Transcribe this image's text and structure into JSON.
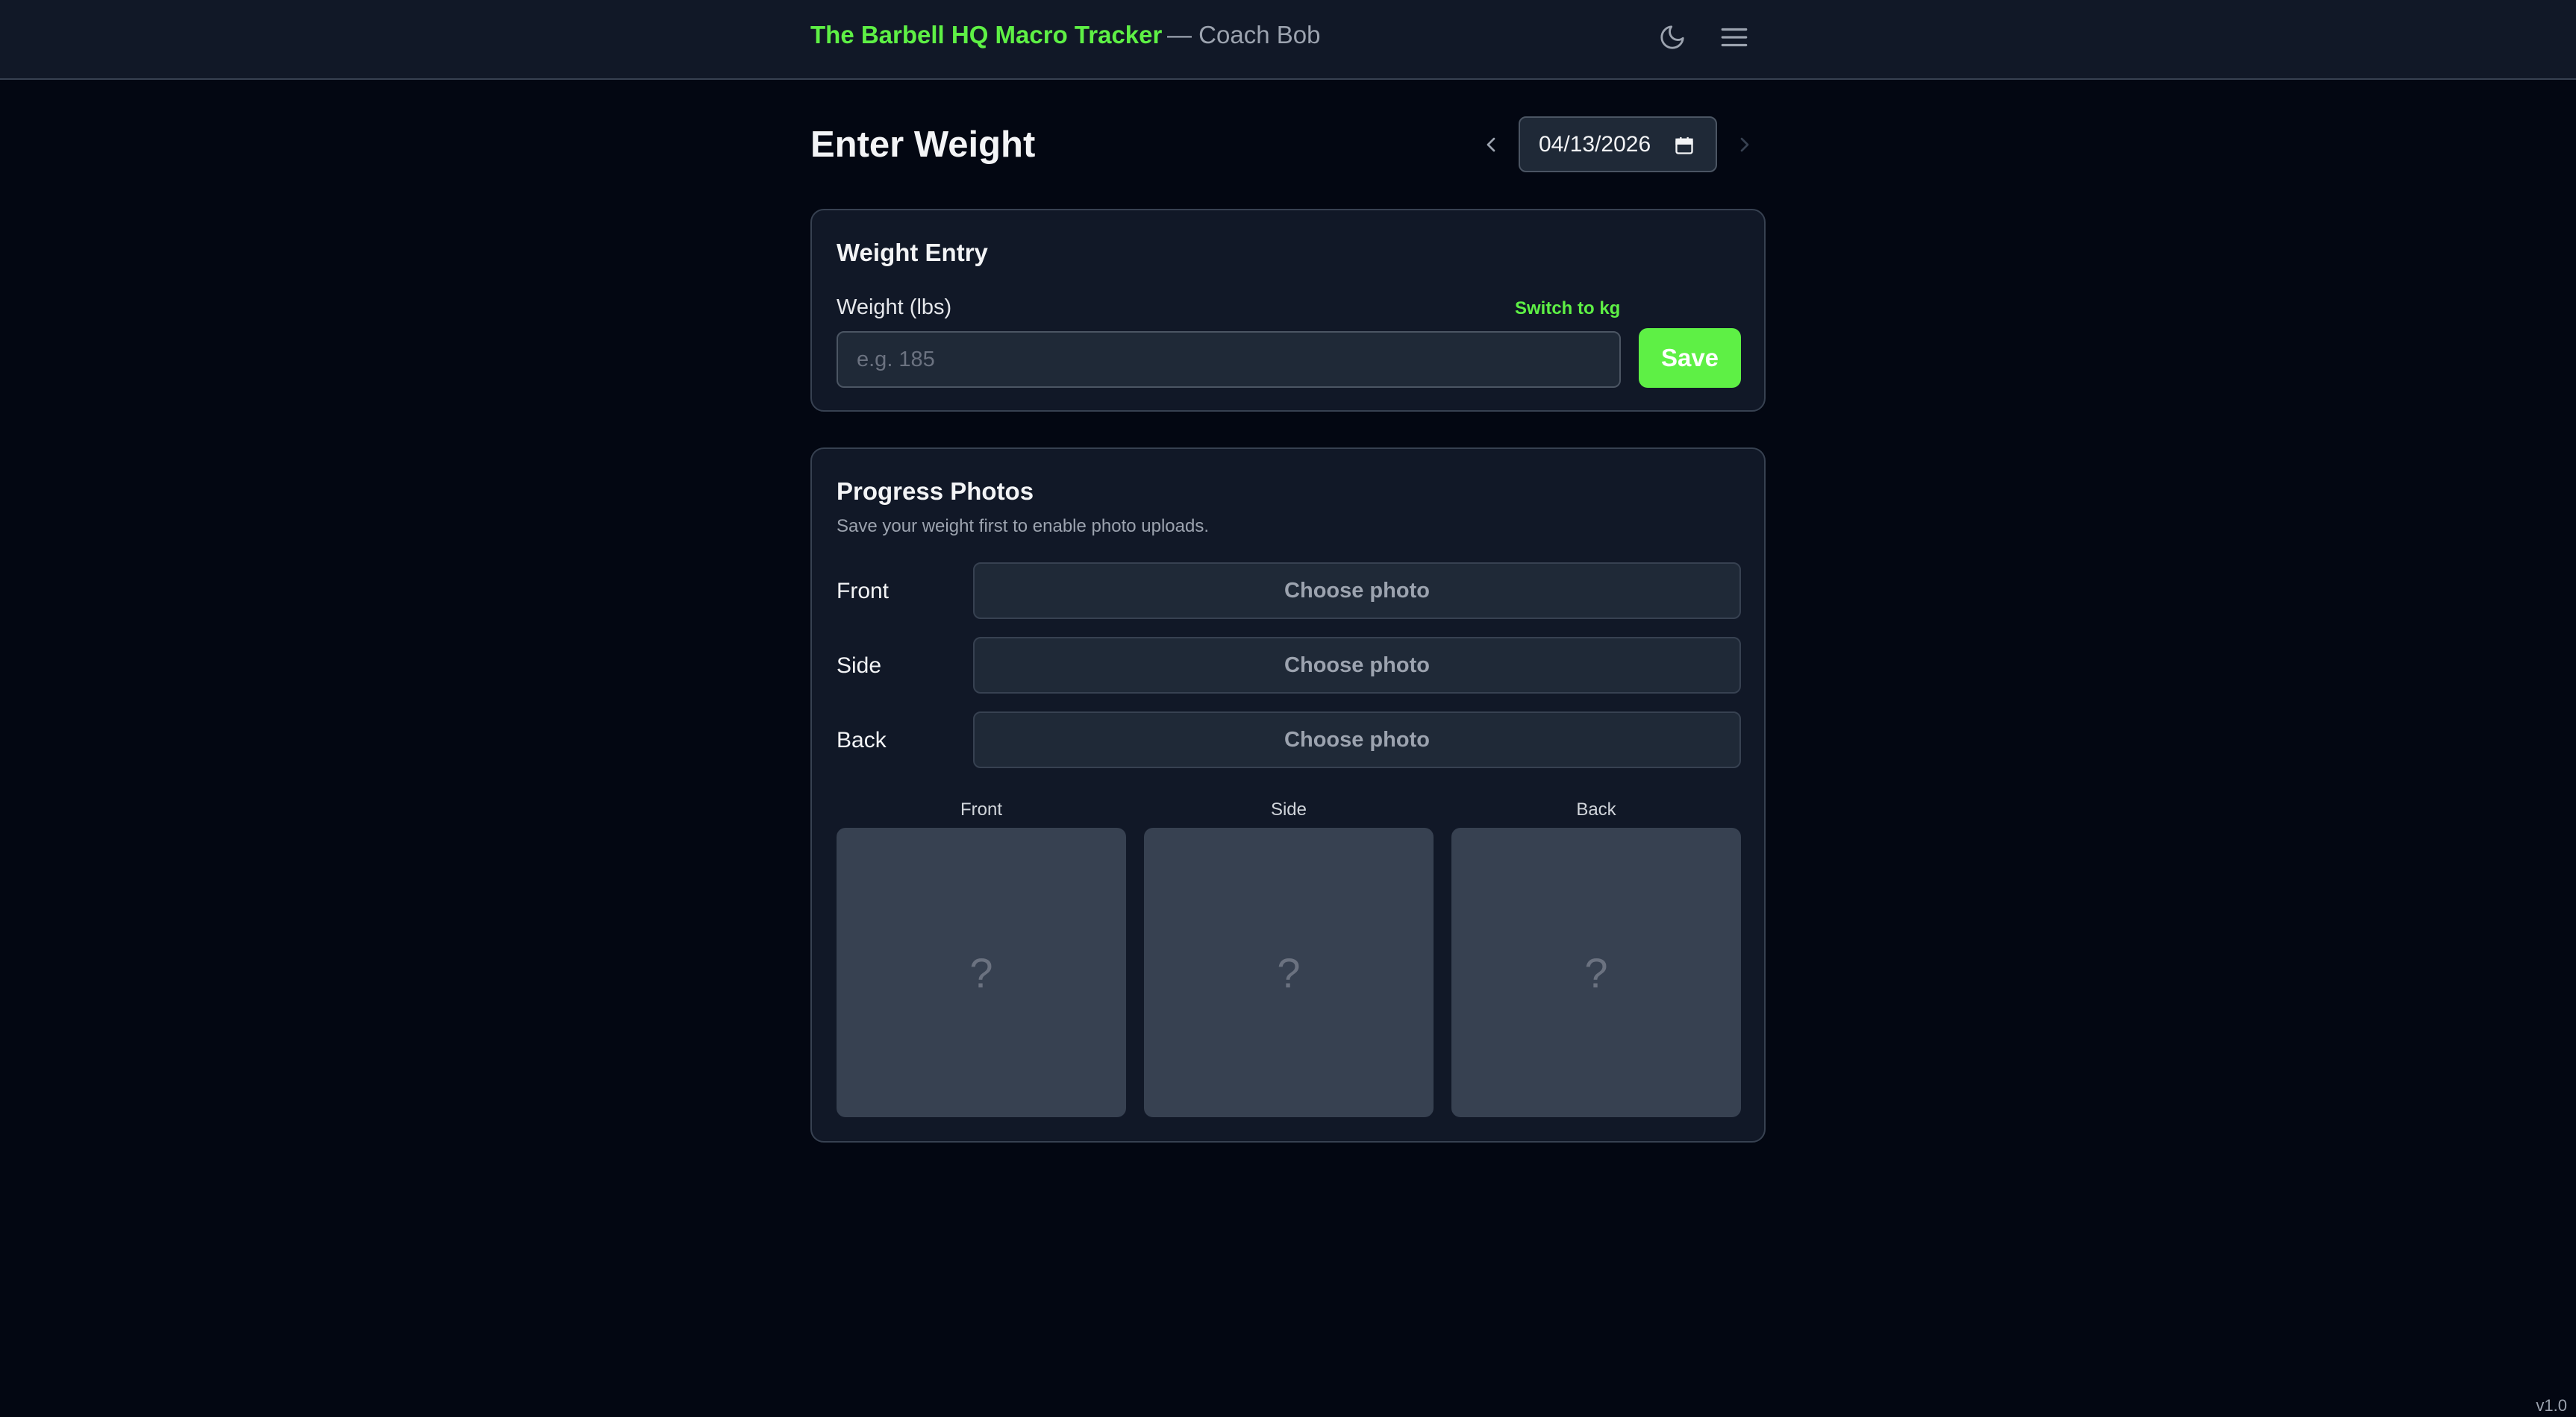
{
  "header": {
    "brand": "The Barbell HQ Macro Tracker",
    "coach": "— Coach Bob",
    "theme_toggle_icon": "moon-icon",
    "menu_icon": "hamburger-menu-icon"
  },
  "page": {
    "title": "Enter Weight",
    "date_value": "04/13/2026",
    "prev_icon": "chevron-left-icon",
    "next_icon": "chevron-right-icon",
    "calendar_icon": "calendar-icon"
  },
  "weight_entry": {
    "title": "Weight Entry",
    "field_label": "Weight (lbs)",
    "switch_unit": "Switch to kg",
    "placeholder": "e.g. 185",
    "value": "",
    "save_label": "Save"
  },
  "progress_photos": {
    "title": "Progress Photos",
    "hint": "Save your weight first to enable photo uploads.",
    "rows": [
      {
        "label": "Front",
        "button": "Choose photo"
      },
      {
        "label": "Side",
        "button": "Choose photo"
      },
      {
        "label": "Back",
        "button": "Choose photo"
      }
    ],
    "thumbnails": [
      {
        "label": "Front",
        "placeholder": "?"
      },
      {
        "label": "Side",
        "placeholder": "?"
      },
      {
        "label": "Back",
        "placeholder": "?"
      }
    ]
  },
  "footer": {
    "version": "v1.0"
  },
  "colors": {
    "accent": "#5ef045",
    "background": "#030712",
    "surface": "#111827",
    "border": "#374151"
  }
}
